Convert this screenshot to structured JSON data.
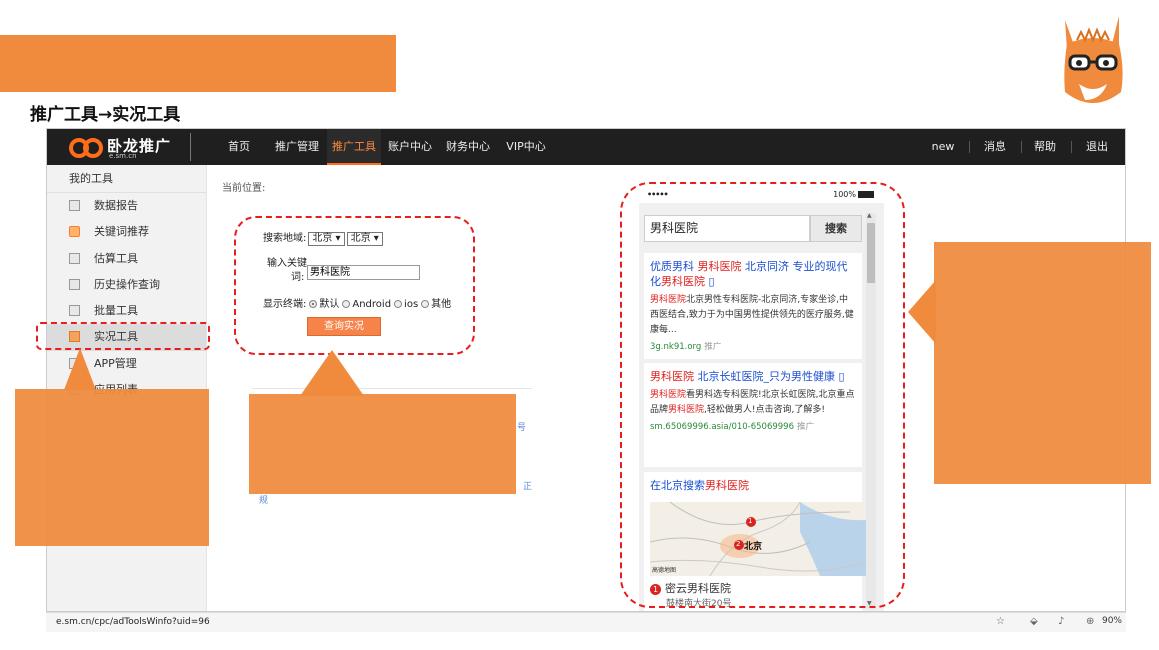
{
  "slide": {
    "title": "推广工具→实况工具"
  },
  "topnav": {
    "logo_name": "卧龙推广",
    "logo_domain": "e.sm.cn",
    "items": [
      "首页",
      "推广管理",
      "推广工具",
      "账户中心",
      "财务中心",
      "VIP中心"
    ],
    "active_index": 2,
    "right": [
      "new",
      "消息",
      "帮助",
      "退出"
    ]
  },
  "sidebar": {
    "header": "我的工具",
    "items": [
      "数据报告",
      "关键词推荐",
      "估算工具",
      "历史操作查询",
      "批量工具",
      "实况工具",
      "APP管理",
      "应用列表"
    ],
    "active_index": 5
  },
  "main": {
    "breadcrumb": "当前位置:",
    "region_label": "搜索地域:",
    "region_province": "北京",
    "region_city": "北京",
    "keyword_label_1": "输入关键",
    "keyword_label_2": "词:",
    "keyword_value": "男科医院",
    "terminal_label": "显示终端:",
    "terminal_options": [
      "默认",
      "Android",
      "ios",
      "其他"
    ],
    "terminal_selected": "默认",
    "query_button": "查询实况",
    "fragment_1": "号",
    "fragment_2": "正",
    "fragment_3": "规"
  },
  "phone": {
    "status_dots": "•••••",
    "battery": "100%",
    "search_value": "男科医院",
    "search_button": "搜索",
    "result1": {
      "title_a": "优质男科 ",
      "title_hl": "男科医院",
      "title_b": " 北京同济 专业的现代化",
      "title_hl2": "男科医院",
      "desc_hl": "男科医院",
      "desc": "北京男性专科医院-北京同济,专家坐诊,中西医结合,致力于为中国男性提供领先的医疗服务,健康每...",
      "url": "3g.nk91.org",
      "ad": "推广"
    },
    "result2": {
      "title_hl": "男科医院",
      "title_b": " 北京长虹医院_只为男性健康",
      "desc_hl": "男科医院",
      "desc": "看男科选专科医院!北京长虹医院,北京重点品牌",
      "desc_hl2": "男科医院",
      "desc2": ",轻松做男人!点击咨询,了解多!",
      "url": "sm.65069996.asia/010-65069996",
      "ad": "推广"
    },
    "result3": {
      "title_a": "在北京搜索",
      "title_hl": "男科医院",
      "map_city": "北京",
      "map_credit": "高德地图",
      "poi_name": "密云男科医院",
      "poi_addr": "鼓楼南大街20号",
      "pin_1": "1",
      "pin_2": "2"
    }
  },
  "browser": {
    "status_url": "e.sm.cn/cpc/adToolsWinfo?uid=96",
    "zoom": "90%"
  },
  "colors": {
    "accent": "#f08a3c",
    "annotation": "#e81d1d",
    "nav_bg": "#1f1f1f"
  }
}
